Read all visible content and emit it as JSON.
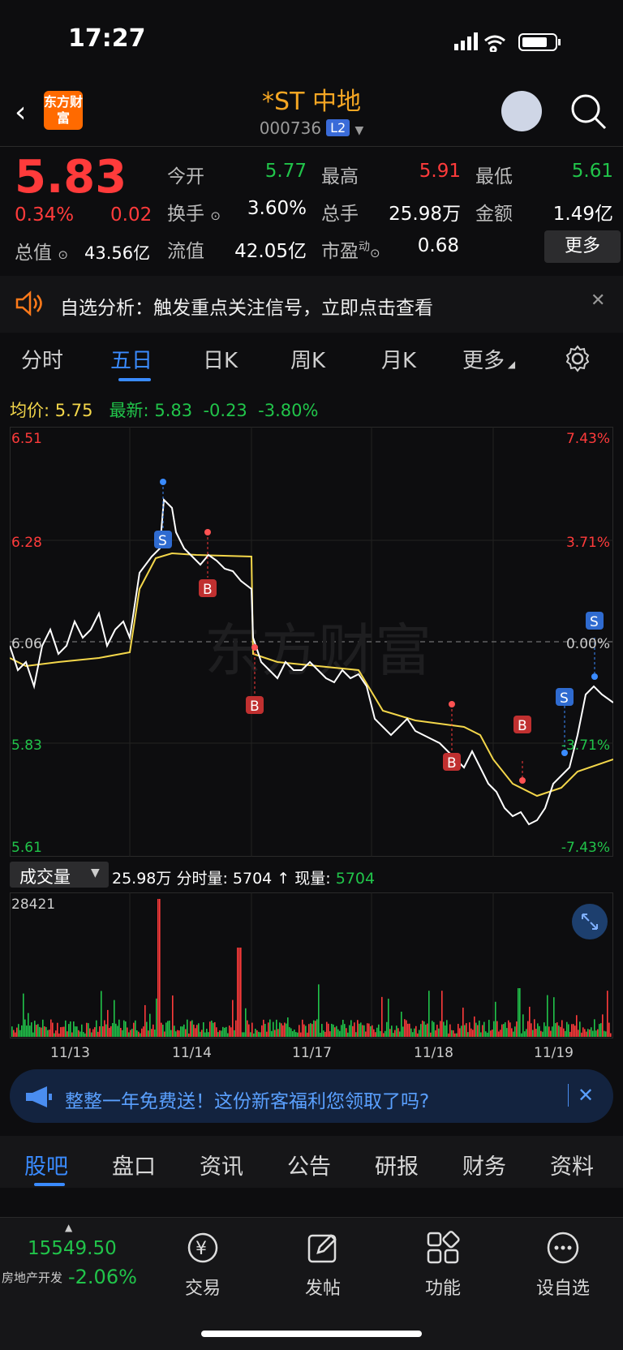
{
  "status": {
    "time": "17:27"
  },
  "header": {
    "logo_text": "东方财富",
    "title": "*ST 中地",
    "code": "000736",
    "level": "L2"
  },
  "quote": {
    "price": "5.83",
    "change_pct": "0.34%",
    "change_amt": "0.02",
    "open_label": "今开",
    "open": "5.77",
    "high_label": "最高",
    "high": "5.91",
    "low_label": "最低",
    "low": "5.61",
    "turnover_label": "换手",
    "turnover": "3.60%",
    "volume_label": "总手",
    "volume": "25.98万",
    "amount_label": "金额",
    "amount": "1.49亿",
    "mktcap_label": "总值",
    "mktcap": "43.56亿",
    "float_label": "流值",
    "float": "42.05亿",
    "pe_label": "市盈",
    "pe_sup": "动",
    "pe": "0.68",
    "more_label": "更多"
  },
  "notice": {
    "text": "自选分析：触发重点关注信号，立即点击查看"
  },
  "tabs": [
    "分时",
    "五日",
    "日K",
    "周K",
    "月K",
    "更多"
  ],
  "info_line": {
    "avg_label": "均价:",
    "avg": "5.75",
    "latest_label": "最新:",
    "latest": "5.83",
    "chg": "-0.23",
    "chg_pct": "-3.80%"
  },
  "chart_data": {
    "type": "line",
    "y_left": [
      "6.51",
      "6.28",
      "6.06",
      "5.83",
      "5.61"
    ],
    "y_right": [
      "7.43%",
      "3.71%",
      "0.00%",
      "-3.71%",
      "-7.43%"
    ],
    "x_labels": [
      "11/13",
      "11/14",
      "11/17",
      "11/18",
      "11/19"
    ],
    "ylim": [
      5.61,
      6.51
    ],
    "watermark": "东方财富"
  },
  "volume": {
    "selector": "成交量",
    "total": "25.98万",
    "time_vol_label": "分时量:",
    "time_vol": "5704",
    "cur_label": "现量:",
    "cur": "5704",
    "max": "28421"
  },
  "banner": {
    "text": "整整一年免费送！这份新客福利您领取了吗?"
  },
  "bottom_tabs": [
    "股吧",
    "盘口",
    "资讯",
    "公告",
    "研报",
    "财务",
    "资料"
  ],
  "nav": {
    "index_value": "15549.50",
    "index_name": "房地产开发",
    "index_chg": "-2.06%",
    "items": [
      "交易",
      "发帖",
      "功能",
      "设自选"
    ]
  }
}
